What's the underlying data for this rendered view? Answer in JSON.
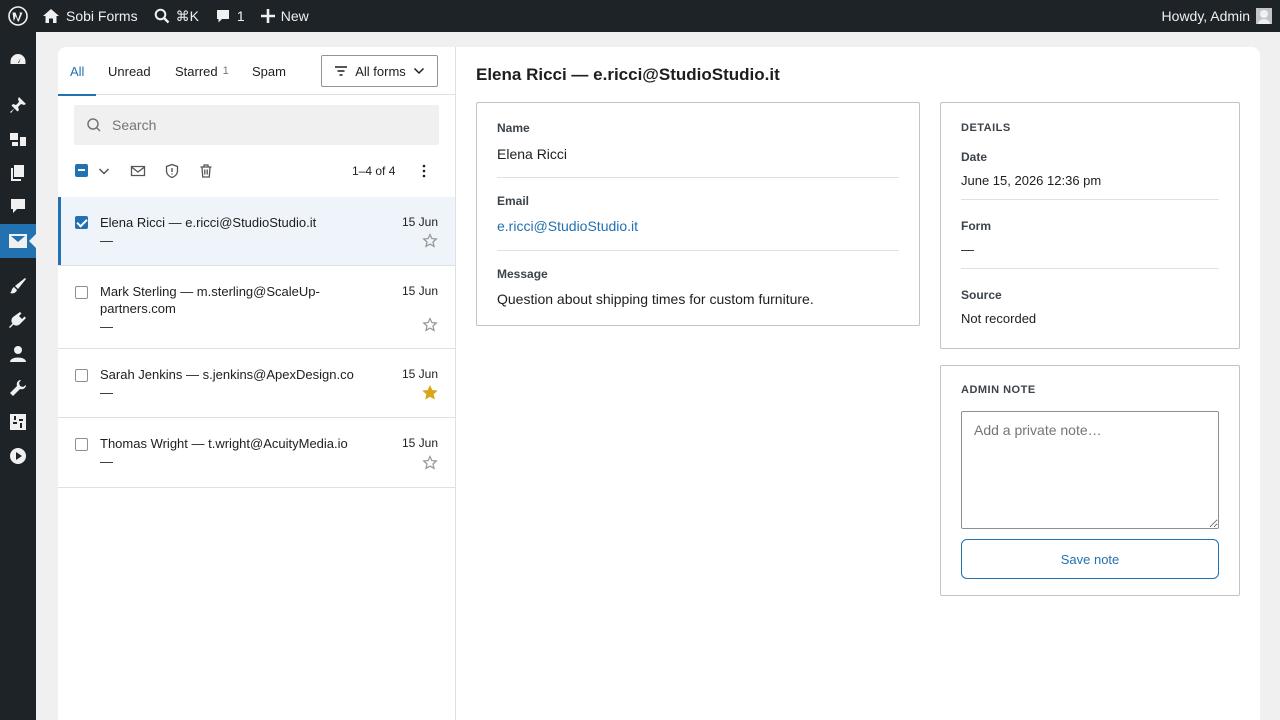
{
  "adminbar": {
    "site_name": "Sobi Forms",
    "search_shortcut": "⌘K",
    "comments_count": "1",
    "new_label": "New",
    "greeting": "Howdy, Admin"
  },
  "tabs": [
    {
      "label": "All",
      "count": ""
    },
    {
      "label": "Unread",
      "count": ""
    },
    {
      "label": "Starred",
      "count": "1"
    },
    {
      "label": "Spam",
      "count": ""
    }
  ],
  "filter": {
    "label": "All forms"
  },
  "search": {
    "placeholder": "Search"
  },
  "pager": {
    "text": "1–4 of 4"
  },
  "entries": [
    {
      "title": "Elena Ricci — e.ricci@StudioStudio.it",
      "subtitle": "—",
      "date": "15 Jun",
      "starred": false,
      "checked": true
    },
    {
      "title": "Mark Sterling — m.sterling@ScaleUp-partners.com",
      "subtitle": "—",
      "date": "15 Jun",
      "starred": false,
      "checked": false
    },
    {
      "title": "Sarah Jenkins — s.jenkins@ApexDesign.co",
      "subtitle": "—",
      "date": "15 Jun",
      "starred": true,
      "checked": false
    },
    {
      "title": "Thomas Wright — t.wright@AcuityMedia.io",
      "subtitle": "—",
      "date": "15 Jun",
      "starred": false,
      "checked": false
    }
  ],
  "detail": {
    "title": "Elena Ricci — e.ricci@StudioStudio.it",
    "fields": {
      "name_label": "Name",
      "name_value": "Elena Ricci",
      "email_label": "Email",
      "email_value": "e.ricci@StudioStudio.it",
      "message_label": "Message",
      "message_value": "Question about shipping times for custom furniture."
    },
    "details": {
      "heading": "Details",
      "date_label": "Date",
      "date_value": "June 15, 2026 12:36 pm",
      "form_label": "Form",
      "form_value": "—",
      "source_label": "Source",
      "source_value": "Not recorded"
    },
    "admin_note": {
      "heading": "Admin note",
      "placeholder": "Add a private note…",
      "save_label": "Save note"
    }
  },
  "colors": {
    "accent": "#2271b1",
    "star": "#dba617",
    "adminbar": "#1d2327"
  }
}
